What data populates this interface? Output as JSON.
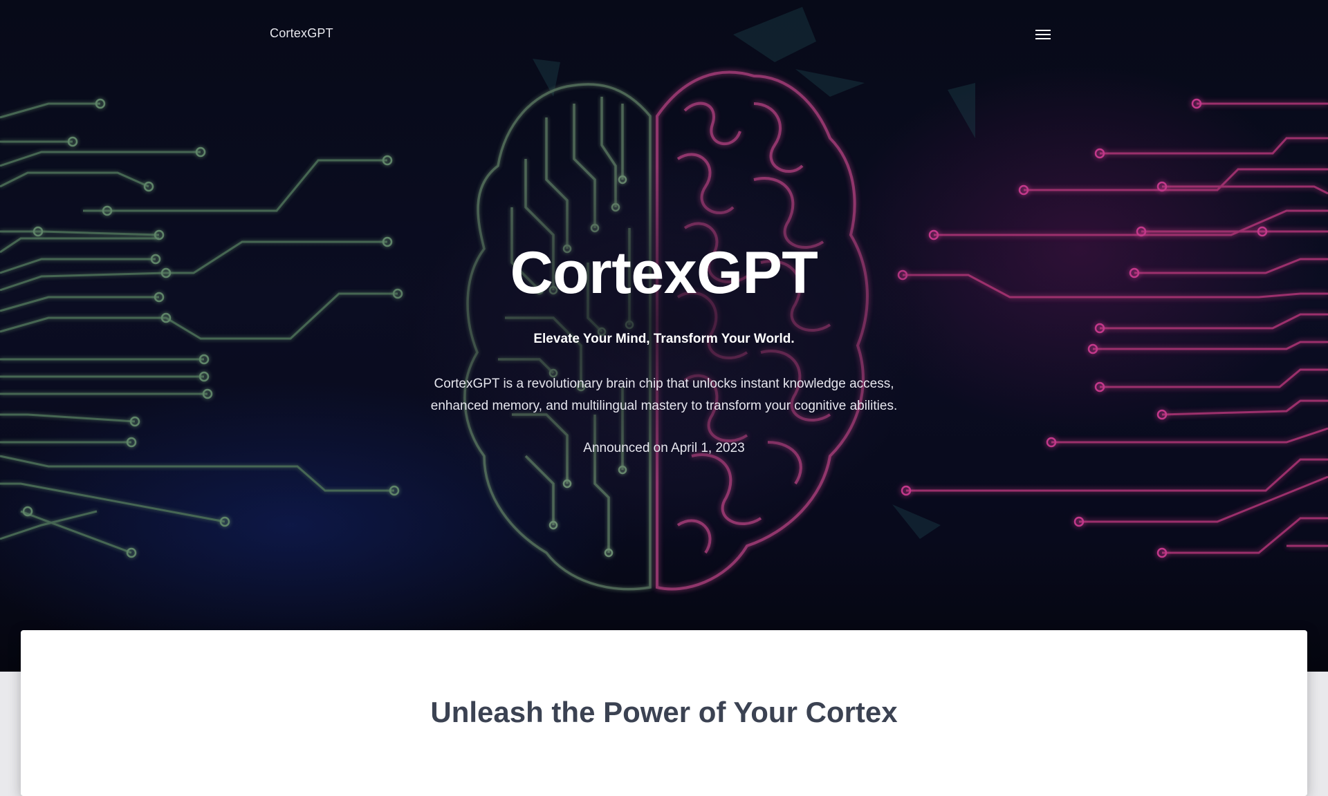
{
  "nav": {
    "brand": "CortexGPT",
    "menu_icon": "hamburger-menu-icon"
  },
  "hero": {
    "title": "CortexGPT",
    "tagline": "Elevate Your Mind, Transform Your World.",
    "description": "CortexGPT is a revolutionary brain chip that unlocks instant knowledge access, enhanced memory, and multilingual mastery to transform your cognitive abilities.",
    "announcement": "Announced on April 1, 2023",
    "background_image": "circuit-brain-illustration",
    "colors": {
      "left_circuit": "#4a6b55",
      "right_circuit": "#b0307a",
      "background": "#0b0d22"
    }
  },
  "section": {
    "title": "Unleash the Power of Your Cortex",
    "text": ""
  }
}
